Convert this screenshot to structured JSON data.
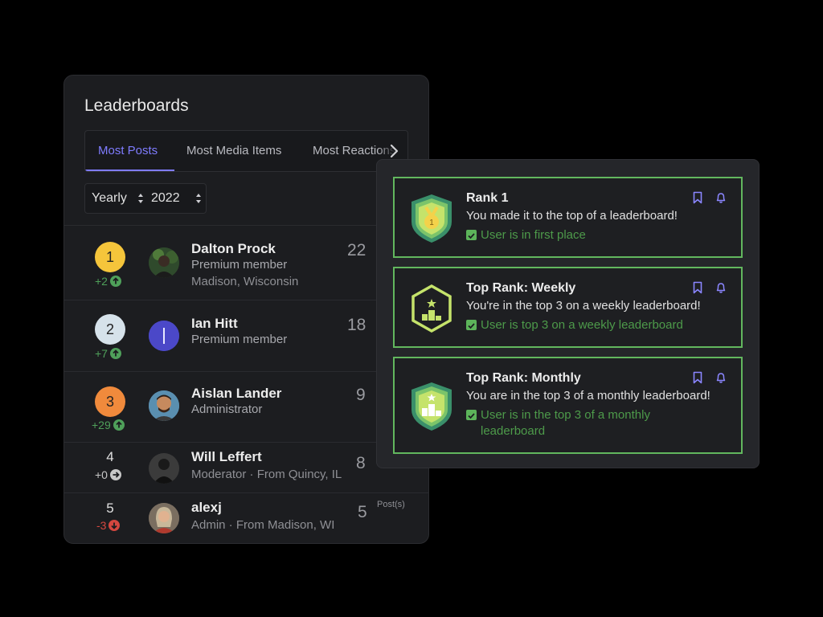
{
  "leaderboard": {
    "title": "Leaderboards",
    "tabs": [
      {
        "label": "Most Posts",
        "active": true
      },
      {
        "label": "Most Media Items",
        "active": false
      },
      {
        "label": "Most Reactions",
        "active": false
      }
    ],
    "filters": {
      "period": "Yearly",
      "year": "2022"
    },
    "rows": [
      {
        "rank": "1",
        "delta": "+2",
        "trend": "up",
        "name": "Dalton Prock",
        "role": "Premium member",
        "location": "Madison, Wisconsin",
        "count": "22"
      },
      {
        "rank": "2",
        "delta": "+7",
        "trend": "up",
        "name": "Ian Hitt",
        "role": "Premium member",
        "location": "",
        "count": "18"
      },
      {
        "rank": "3",
        "delta": "+29",
        "trend": "up",
        "name": "Aislan Lander",
        "role": "Administrator",
        "location": "",
        "count": "9"
      },
      {
        "rank": "4",
        "delta": "+0",
        "trend": "flat",
        "name": "Will Leffert",
        "role": "Moderator · From Quincy, IL",
        "location": "",
        "count": "8"
      },
      {
        "rank": "5",
        "delta": "-3",
        "trend": "down",
        "name": "alexj",
        "role": "Admin · From Madison, WI",
        "location": "",
        "count": "5",
        "unit": "Post(s)"
      }
    ]
  },
  "achievements": [
    {
      "title": "Rank 1",
      "description": "You made it to the top of a leaderboard!",
      "condition": "User is in first place",
      "icon": "medal-badge-icon"
    },
    {
      "title": "Top Rank: Weekly",
      "description": "You're in the top 3 on a weekly leaderboard!",
      "condition": "User is top 3 on a weekly leaderboard",
      "icon": "podium-outline-badge-icon"
    },
    {
      "title": "Top Rank: Monthly",
      "description": "You are in the top 3 of a monthly leaderboard!",
      "condition": "User is in the top 3 of a monthly leaderboard",
      "icon": "podium-badge-icon"
    }
  ],
  "colors": {
    "accent": "#7f7cff",
    "success": "#62b75e",
    "gold": "#f5c53b",
    "silver": "#d6e2ea",
    "bronze": "#f08a3c",
    "down": "#d4473f"
  }
}
